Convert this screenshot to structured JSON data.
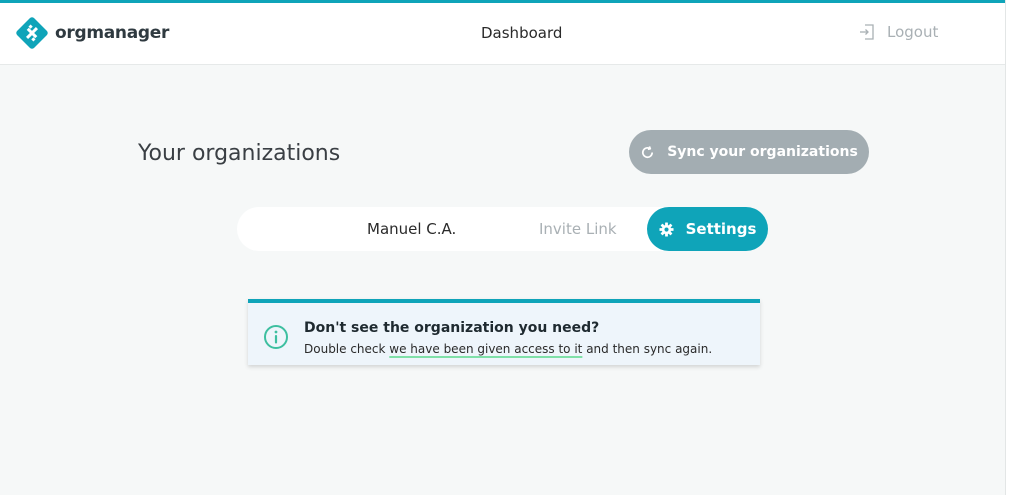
{
  "header": {
    "brand": "orgmanager",
    "nav_dashboard": "Dashboard",
    "logout_label": "Logout",
    "logout_icon": "sign-out-icon"
  },
  "main": {
    "title": "Your organizations",
    "sync_button_label": "Sync your organizations",
    "sync_icon": "refresh-icon",
    "tabs": [
      {
        "label": "Manuel C.A.",
        "active": false
      },
      {
        "label": "Invite Link",
        "active": false
      },
      {
        "label": "Settings",
        "active": true,
        "icon": "gear-icon"
      }
    ]
  },
  "notice": {
    "icon": "info-icon",
    "title": "Don't see the organization you need?",
    "text_before": "Double check ",
    "link_text": "we have been given access to it",
    "text_after": " and then sync again."
  },
  "colors": {
    "accent": "#0fa4b9",
    "sync_button": "#a3adb2",
    "info_icon": "#3dbfa0",
    "link_underline": "#7fe0a8",
    "background": "#f6f8f8"
  }
}
